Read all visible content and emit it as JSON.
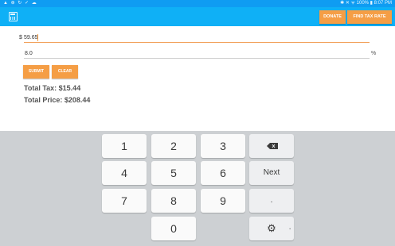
{
  "status_bar": {
    "left_icons": "▲ ⊕ ↻ ✓ ☁",
    "right_text": "✱ ✕ ᯤ 100% ▮ 8:07 PM"
  },
  "toolbar": {
    "app_icon": "calculator-icon",
    "donate_label": "DONATE",
    "find_tax_rate_label": "FIND TAX RATE"
  },
  "form": {
    "price_prefix": "$",
    "price_value": "59.65",
    "rate_value": "8.0",
    "rate_suffix": "%",
    "submit_label": "SUBMIT",
    "clear_label": "CLEAR"
  },
  "results": {
    "total_tax": "Total Tax: $15.44",
    "total_price": "Total Price: $208.44"
  },
  "keypad": {
    "k1": "1",
    "k2": "2",
    "k3": "3",
    "k4": "4",
    "k5": "5",
    "k6": "6",
    "k7": "7",
    "k8": "8",
    "k9": "9",
    "k0": "0",
    "next": "Next",
    "dot": ".",
    "backspace_icon": "backspace-icon",
    "settings_icon": "gear-icon"
  }
}
